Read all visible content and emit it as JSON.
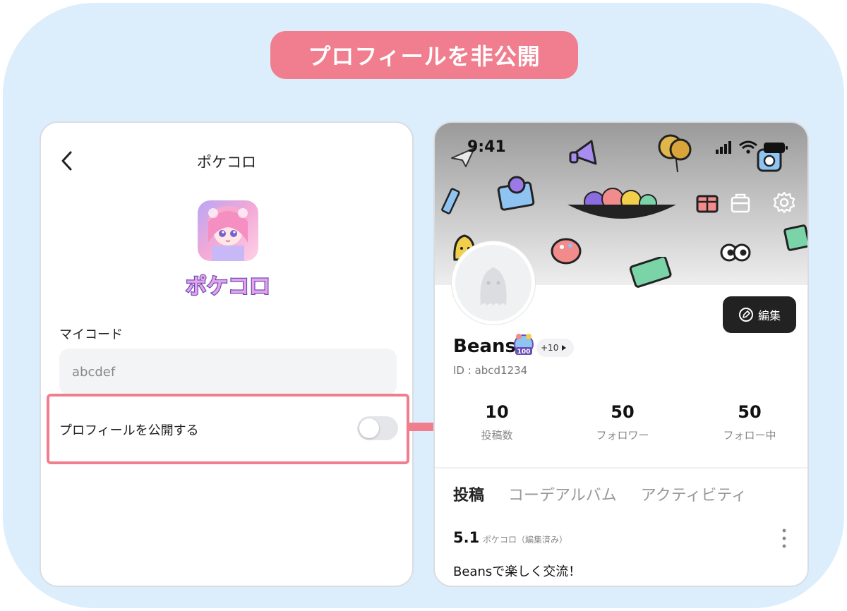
{
  "banner": {
    "title": "プロフィールを非公開"
  },
  "settings_screen": {
    "title": "ポケコロ",
    "app_logo_text": "ポケコロ",
    "mycode_label": "マイコード",
    "mycode_value": "abcdef",
    "public_profile_label": "プロフィールを公開する",
    "public_profile_enabled": false
  },
  "profile_screen": {
    "status_time": "9:41",
    "edit_label": "編集",
    "user_name": "Beans",
    "badge_text": "100",
    "badge_more": "+10",
    "user_id": "ID : abcd1234",
    "stats": [
      {
        "value": "10",
        "label": "投稿数"
      },
      {
        "value": "50",
        "label": "フォロワー"
      },
      {
        "value": "50",
        "label": "フォロー中"
      }
    ],
    "tabs": [
      {
        "label": "投稿",
        "active": true
      },
      {
        "label": "コーデアルバム",
        "active": false
      },
      {
        "label": "アクティビティ",
        "active": false
      }
    ],
    "post": {
      "date": "5.1",
      "meta": "ポケコロ（編集済み）",
      "text": "Beansで楽しく交流！"
    }
  },
  "colors": {
    "background": "#dcedfb",
    "accent_pink": "#f07e8e",
    "toggle_off": "#e4e6ea",
    "edit_button": "#222222"
  },
  "icons": [
    "back-chevron-icon",
    "shop-icon",
    "settings-gear-icon",
    "pencil-icon",
    "kebab-menu-icon",
    "signal-icon",
    "wifi-icon",
    "battery-icon",
    "arrow-right-icon"
  ]
}
